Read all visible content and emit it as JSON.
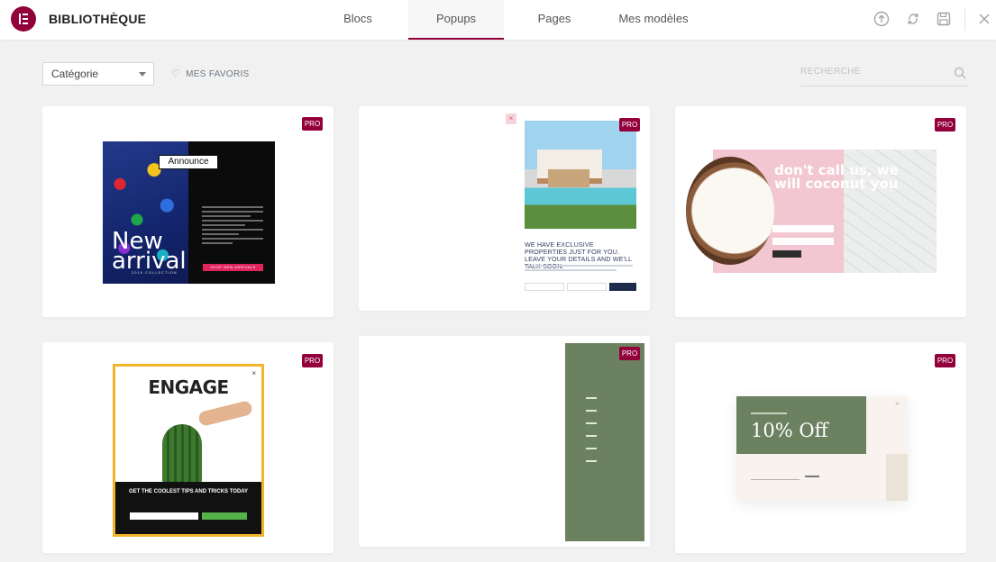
{
  "header": {
    "brand": "BIBLIOTHÈQUE",
    "tabs": [
      {
        "label": "Blocs",
        "active": false
      },
      {
        "label": "Popups",
        "active": true
      },
      {
        "label": "Pages",
        "active": false
      },
      {
        "label": "Mes modèles",
        "active": false
      }
    ],
    "icons": [
      "upload-icon",
      "sync-icon",
      "save-icon",
      "close-icon"
    ]
  },
  "toolbar": {
    "category_value": "Catégorie",
    "favorites_label": "MES FAVORIS",
    "search_placeholder": "RECHERCHE"
  },
  "badges": {
    "pro": "PRO"
  },
  "templates": {
    "card1": {
      "announce": "Announce",
      "new_label": "New",
      "arrival_label": "arrival",
      "collection": "2019 COLLECTION",
      "cta": "SHOP NEW ARRIVALS"
    },
    "card2": {
      "close": "×",
      "headline": "WE HAVE EXCLUSIVE PROPERTIES JUST FOR YOU. LEAVE YOUR DETAILS AND WE'LL TALK SOON."
    },
    "card3": {
      "headline": "don't call us, we will coconut you"
    },
    "card4": {
      "headline": "ENGAGE",
      "close": "×",
      "tips": "GET THE COOLEST TIPS AND TRICKS TODAY"
    },
    "card6": {
      "headline": "10% Off",
      "close": "×"
    }
  },
  "colors": {
    "accent": "#92003b",
    "sage": "#6b8160"
  }
}
